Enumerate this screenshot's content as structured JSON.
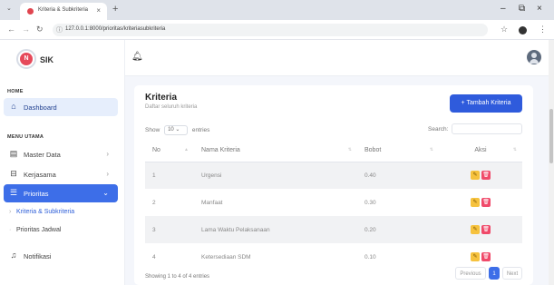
{
  "browser": {
    "tab_title": "Kriteria & Subkriteria",
    "url": "127.0.0.1:8000/prioritas/kriteriasubkriteria",
    "new_tab": "+",
    "win_min": "–",
    "win_max": "⧉",
    "win_close": "×"
  },
  "brand": {
    "logo_letter": "N",
    "name": "SIK"
  },
  "sidebar": {
    "home_label": "HOME",
    "dashboard": "Dashboard",
    "menu_label": "MENU UTAMA",
    "items": [
      {
        "label": "Master Data"
      },
      {
        "label": "Kerjasama"
      },
      {
        "label": "Prioritas"
      }
    ],
    "sub_items": [
      {
        "label": "Kriteria & Subkriteria"
      },
      {
        "label": "Prioritas Jadwal"
      }
    ],
    "notifikasi": "Notifikasi"
  },
  "card": {
    "title": "Kriteria",
    "subtitle": "Daftar seluruh kriteria",
    "add_button": "+ Tambah Kriteria",
    "show_label": "Show",
    "show_value": "10",
    "entries_label": "entries",
    "search_label": "Search:"
  },
  "table": {
    "headers": [
      "No",
      "Nama Kriteria",
      "Bobot",
      "Aksi"
    ],
    "rows": [
      {
        "no": "1",
        "nama": "Urgensi",
        "bobot": "0.40"
      },
      {
        "no": "2",
        "nama": "Manfaat",
        "bobot": "0.30"
      },
      {
        "no": "3",
        "nama": "Lama Waktu Pelaksanaan",
        "bobot": "0.20"
      },
      {
        "no": "4",
        "nama": "Ketersediaan SDM",
        "bobot": "0.10"
      }
    ]
  },
  "footer": {
    "info": "Showing 1 to 4 of 4 entries",
    "previous": "Previous",
    "page": "1",
    "next": "Next"
  },
  "colors": {
    "primary": "#2f5bdc",
    "edit": "#f6c23e",
    "delete": "#f04a6a"
  }
}
